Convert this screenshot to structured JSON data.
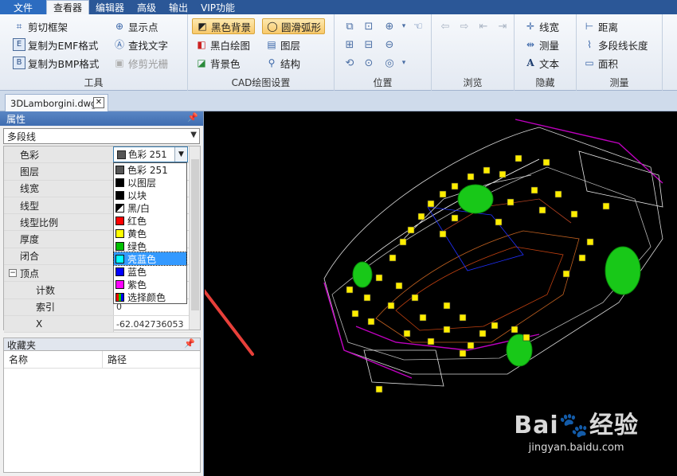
{
  "menubar": {
    "file": "文件",
    "items": [
      "查看器",
      "编辑器",
      "高级",
      "输出",
      "VIP功能"
    ]
  },
  "ribbon": {
    "tools": {
      "label": "工具",
      "clip_frame": "剪切框架",
      "copy_emf": "复制为EMF格式",
      "copy_bmp": "复制为BMP格式",
      "show_points": "显示点",
      "find_text": "查找文字",
      "trim_raster": "修剪光栅"
    },
    "cad_settings": {
      "label": "CAD绘图设置",
      "black_bg": "黑色背景",
      "smooth_arc": "圆滑弧形",
      "bw_drawing": "黑白绘图",
      "layers": "图层",
      "bg_color": "背景色",
      "structure": "结构"
    },
    "position": {
      "label": "位置"
    },
    "browse": {
      "label": "浏览"
    },
    "hide": {
      "label": "隐藏",
      "lineweight": "线宽",
      "measure": "测量",
      "text": "文本"
    },
    "measure": {
      "label": "测量",
      "distance": "距离",
      "polyline_length": "多段线长度",
      "area": "面积"
    }
  },
  "document_tab": {
    "title": "3DLamborgini.dwg"
  },
  "properties": {
    "title": "属性",
    "object_type": "多段线",
    "rows": [
      {
        "key": "色彩",
        "value": ""
      },
      {
        "key": "图层",
        "value": ""
      },
      {
        "key": "线宽",
        "value": ""
      },
      {
        "key": "线型",
        "value": ""
      },
      {
        "key": "线型比例",
        "value": ""
      },
      {
        "key": "厚度",
        "value": ""
      },
      {
        "key": "闭合",
        "value": ""
      },
      {
        "key": "顶点",
        "value": ""
      },
      {
        "key": "计数",
        "value": ""
      },
      {
        "key": "索引",
        "value": "0"
      },
      {
        "key": "X",
        "value": "-62.042736053"
      }
    ],
    "color_combo": {
      "value": "色彩 251",
      "swatch": "#555555"
    },
    "color_options": [
      {
        "label": "色彩 251",
        "color": "#555555"
      },
      {
        "label": "以图层",
        "color": "#000000"
      },
      {
        "label": "以块",
        "color": "#000000"
      },
      {
        "label": "黑/白",
        "color": "#000000"
      },
      {
        "label": "红色",
        "color": "#ff0000"
      },
      {
        "label": "黄色",
        "color": "#ffff00"
      },
      {
        "label": "绿色",
        "color": "#00c000"
      },
      {
        "label": "亮蓝色",
        "color": "#00ffff"
      },
      {
        "label": "蓝色",
        "color": "#0000ff"
      },
      {
        "label": "紫色",
        "color": "#ff00ff"
      },
      {
        "label": "选择颜色",
        "color": "#888888"
      }
    ],
    "selected_option": "亮蓝色"
  },
  "favorites": {
    "title": "收藏夹",
    "col_name": "名称",
    "col_path": "路径"
  },
  "watermark": {
    "brand": "Bai",
    "brand2": "经验",
    "url": "jingyan.baidu.com"
  },
  "colors": {
    "accent": "#2b5797",
    "selection": "#3399ff",
    "annotation_arrow": "#e8403a"
  }
}
